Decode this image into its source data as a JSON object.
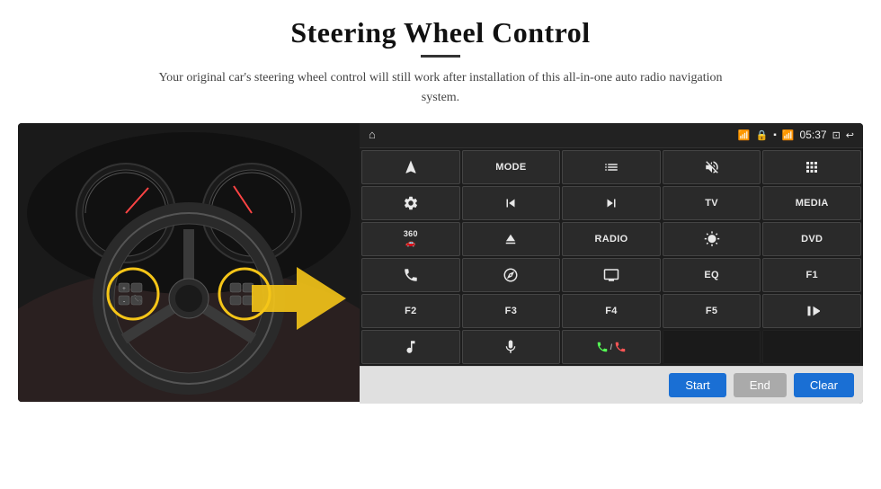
{
  "header": {
    "title": "Steering Wheel Control",
    "subtitle": "Your original car's steering wheel control will still work after installation of this all-in-one auto radio navigation system."
  },
  "status_bar": {
    "time": "05:37",
    "icons": [
      "home",
      "wifi",
      "lock",
      "sd-card",
      "bluetooth",
      "battery",
      "back"
    ]
  },
  "grid_buttons": [
    [
      {
        "label": "nav",
        "type": "icon",
        "icon": "navigate"
      },
      {
        "label": "MODE",
        "type": "text"
      },
      {
        "label": "list",
        "type": "icon",
        "icon": "list"
      },
      {
        "label": "mute",
        "type": "icon",
        "icon": "volume-x"
      },
      {
        "label": "apps",
        "type": "icon",
        "icon": "apps"
      }
    ],
    [
      {
        "label": "settings",
        "type": "icon",
        "icon": "gear"
      },
      {
        "label": "prev",
        "type": "icon",
        "icon": "skip-back"
      },
      {
        "label": "next",
        "type": "icon",
        "icon": "skip-forward"
      },
      {
        "label": "TV",
        "type": "text"
      },
      {
        "label": "MEDIA",
        "type": "text"
      }
    ],
    [
      {
        "label": "360cam",
        "type": "icon",
        "icon": "360"
      },
      {
        "label": "eject",
        "type": "icon",
        "icon": "eject"
      },
      {
        "label": "RADIO",
        "type": "text"
      },
      {
        "label": "brightness",
        "type": "icon",
        "icon": "sun"
      },
      {
        "label": "DVD",
        "type": "text"
      }
    ],
    [
      {
        "label": "phone",
        "type": "icon",
        "icon": "phone"
      },
      {
        "label": "navi",
        "type": "icon",
        "icon": "compass"
      },
      {
        "label": "display",
        "type": "icon",
        "icon": "monitor"
      },
      {
        "label": "EQ",
        "type": "text"
      },
      {
        "label": "F1",
        "type": "text"
      }
    ],
    [
      {
        "label": "F2",
        "type": "text"
      },
      {
        "label": "F3",
        "type": "text"
      },
      {
        "label": "F4",
        "type": "text"
      },
      {
        "label": "F5",
        "type": "text"
      },
      {
        "label": "play-pause",
        "type": "icon",
        "icon": "play-pause"
      }
    ],
    [
      {
        "label": "music",
        "type": "icon",
        "icon": "music"
      },
      {
        "label": "microphone",
        "type": "icon",
        "icon": "mic"
      },
      {
        "label": "phone-answer",
        "type": "icon",
        "icon": "phone-answer"
      },
      {
        "label": "",
        "type": "empty"
      },
      {
        "label": "",
        "type": "empty"
      }
    ]
  ],
  "action_bar": {
    "start_label": "Start",
    "end_label": "End",
    "clear_label": "Clear"
  }
}
